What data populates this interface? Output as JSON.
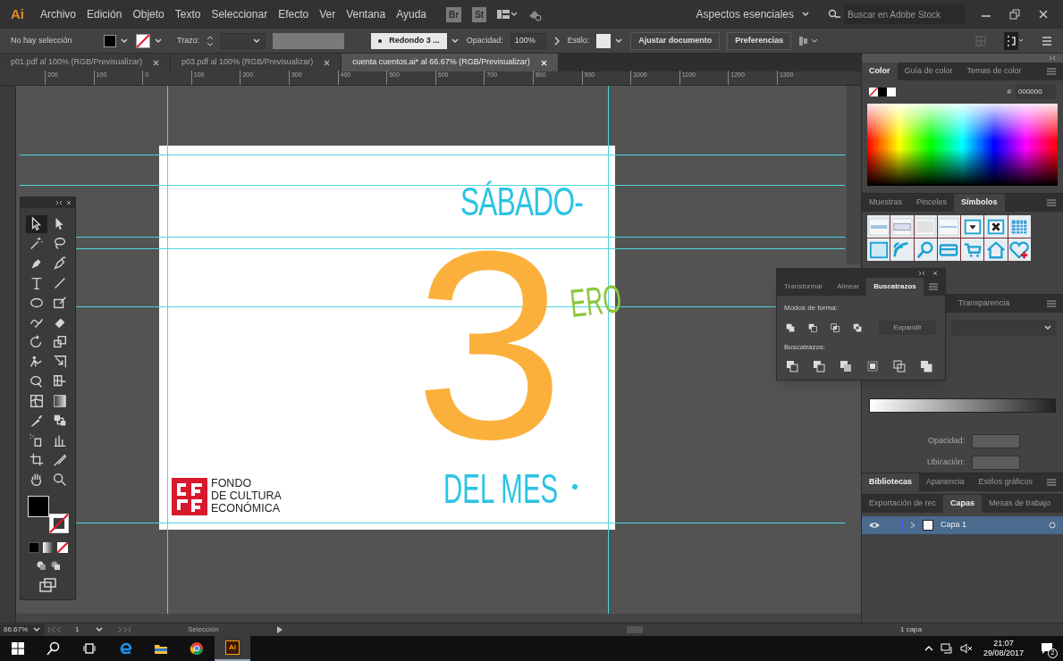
{
  "menu_bar": {
    "app_logo": "Ai",
    "menus": [
      "Archivo",
      "Edición",
      "Objeto",
      "Texto",
      "Seleccionar",
      "Efecto",
      "Ver",
      "Ventana",
      "Ayuda"
    ],
    "bridge_buttons": [
      "Br",
      "St"
    ],
    "workspace": "Aspectos esenciales",
    "search": {
      "placeholder": "Buscar en Adobe Stock"
    }
  },
  "control_bar": {
    "selection_status": "No hay selección",
    "stroke_label": "Trazo:",
    "brush": "Redondo 3 ...",
    "opacity_label": "Opacidad:",
    "opacity": "100%",
    "style_label": "Estilo:",
    "buttons": [
      "Ajustar documento",
      "Preferencias"
    ]
  },
  "document_tabs": [
    {
      "label": "p01.pdf al 100% (RGB/Previsualizar)",
      "selected": false
    },
    {
      "label": "p03.pdf al 100% (RGB/Previsualizar)",
      "selected": false
    },
    {
      "label": "cuenta cuentos.ai* al 66.67% (RGB/Previsualizar)",
      "selected": true
    }
  ],
  "ruler": {
    "labels": [
      "200",
      "100",
      "0",
      "100",
      "200",
      "300",
      "400",
      "500",
      "600",
      "700",
      "800",
      "900",
      "1000",
      "1100",
      "1200",
      "1300"
    ]
  },
  "artboard": {
    "title": "SÁBADO-",
    "number": "3",
    "ordinal": "ERO",
    "subtitle": "DEL MES",
    "logo_lines": [
      "FONDO",
      "DE CULTURA",
      "ECONÓMICA"
    ]
  },
  "tools": [
    {
      "kind": "selection",
      "selected": true
    },
    {
      "kind": "direct-selection",
      "selected": false
    },
    {
      "kind": "magic-wand",
      "selected": false
    },
    {
      "kind": "lasso",
      "selected": false
    },
    {
      "kind": "pen",
      "selected": false
    },
    {
      "kind": "curvature",
      "selected": false
    },
    {
      "kind": "type",
      "selected": false
    },
    {
      "kind": "line",
      "selected": false
    },
    {
      "kind": "ellipse",
      "selected": false
    },
    {
      "kind": "paintbrush",
      "selected": false
    },
    {
      "kind": "shaper",
      "selected": false
    },
    {
      "kind": "eraser",
      "selected": false
    },
    {
      "kind": "rotate",
      "selected": false
    },
    {
      "kind": "scale",
      "selected": false
    },
    {
      "kind": "puppet-warp",
      "selected": false
    },
    {
      "kind": "free-transform",
      "selected": false
    },
    {
      "kind": "shape-builder",
      "selected": false
    },
    {
      "kind": "perspective",
      "selected": false
    },
    {
      "kind": "mesh",
      "selected": false
    },
    {
      "kind": "gradient",
      "selected": false
    },
    {
      "kind": "eyedropper",
      "selected": false
    },
    {
      "kind": "blend",
      "selected": false
    },
    {
      "kind": "symbol-sprayer",
      "selected": false
    },
    {
      "kind": "graph",
      "selected": false
    },
    {
      "kind": "artboard",
      "selected": false
    },
    {
      "kind": "knife",
      "selected": false
    },
    {
      "kind": "hand",
      "selected": false
    },
    {
      "kind": "zoom",
      "selected": false
    }
  ],
  "color_panel": {
    "tabs": [
      {
        "label": "Color",
        "selected": true
      },
      {
        "label": "Guía de color",
        "selected": false
      },
      {
        "label": "Temas de color",
        "selected": false
      }
    ],
    "hex_prefix": "#",
    "hex": "000000"
  },
  "symbols_panel": {
    "tabs": [
      {
        "label": "Muestras",
        "selected": false
      },
      {
        "label": "Pinceles",
        "selected": false
      },
      {
        "label": "Símbolos",
        "selected": true
      }
    ]
  },
  "pathfinder_panel": {
    "tabs": [
      {
        "label": "Transformar",
        "selected": false
      },
      {
        "label": "Alinear",
        "selected": false
      },
      {
        "label": "Buscatrazos",
        "selected": true
      }
    ],
    "shape_modes_label": "Modos de forma:",
    "expand_button": "Expandir",
    "pathfinders_label": "Buscatrazos:"
  },
  "gradient_panel": {
    "tabs": [
      {
        "label": "Transparencia",
        "selected": false
      }
    ],
    "opacity_label": "Opacidad:",
    "location_label": "Ubicación:"
  },
  "libraries_panel": {
    "tabs": [
      {
        "label": "Bibliotecas",
        "selected": true
      },
      {
        "label": "Apariencia",
        "selected": false
      },
      {
        "label": "Estilos gráficos",
        "selected": false
      }
    ]
  },
  "layers_panel": {
    "tabs": [
      {
        "label": "Exportación de rec",
        "selected": false
      },
      {
        "label": "Capas",
        "selected": true
      },
      {
        "label": "Mesas de trabajo",
        "selected": false
      }
    ],
    "layers": [
      {
        "name": "Capa 1",
        "visible": true,
        "selected": true
      }
    ],
    "count": "1 capa"
  },
  "status_bar": {
    "zoom": "66.67%",
    "artboard": "1",
    "tool": "Selección"
  },
  "taskbar": {
    "app_label": "Ai",
    "time": "21:07",
    "date": "29/08/2017",
    "notifications": "2"
  }
}
